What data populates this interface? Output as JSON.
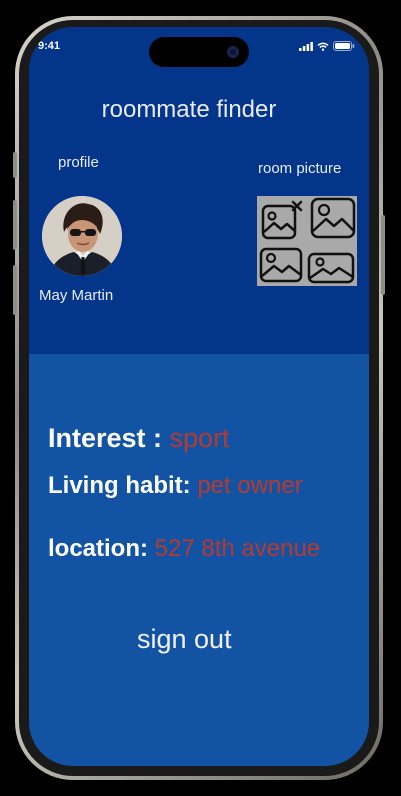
{
  "status": {
    "time": "9:41"
  },
  "app": {
    "title": "roommate finder"
  },
  "profile": {
    "label": "profile",
    "name": "May Martin"
  },
  "room": {
    "label": "room picture"
  },
  "details": {
    "interest_label": "Interest : ",
    "interest_value": "sport",
    "habit_label": "Living habit: ",
    "habit_value": "pet owner",
    "location_label": "location: ",
    "location_value": "527 8th avenue"
  },
  "actions": {
    "sign_out": "sign out"
  },
  "colors": {
    "header_bg": "#03358a",
    "body_bg": "#1254a3",
    "value_text": "#b83a2e",
    "label_text": "#ffffff"
  }
}
